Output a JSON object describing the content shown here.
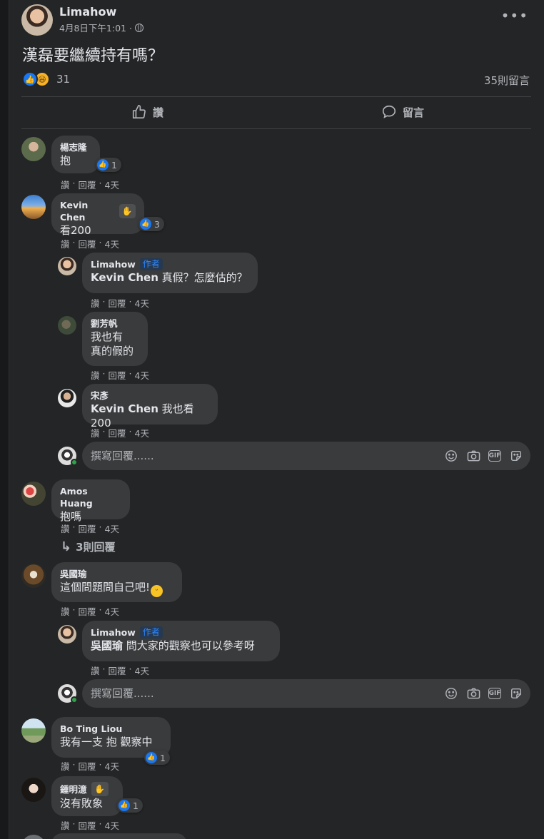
{
  "post": {
    "author": "Limahow",
    "date": "4月8日下午1:01 ·",
    "text": "漢磊要繼續持有嗎？",
    "reaction_count": "31",
    "comment_count": "35則留言",
    "like_label": "讚",
    "comment_label": "留言"
  },
  "common": {
    "like": "讚",
    "reply": "回覆",
    "sep": "·",
    "time": "4天",
    "author_tag": "作者",
    "reply_placeholder": "撰寫回覆......",
    "gif": "GIF"
  },
  "comments": [
    {
      "name": "楊志隆",
      "text": "抱",
      "likes": "1"
    },
    {
      "name": "Kevin Chen",
      "text": "看200",
      "likes": "3"
    },
    {
      "name": "Limahow",
      "mention": "Kevin Chen",
      "text": " 真假？怎麼估的？"
    },
    {
      "name": "劉芳帆",
      "text_line1": "我也有",
      "text_line2": "真的假的"
    },
    {
      "name": "宋彥",
      "mention": "Kevin Chen",
      "text": " 我也看200"
    },
    {
      "name": "Amos Huang",
      "text": "抱嗎",
      "view_replies": "3則回覆"
    },
    {
      "name": "吳國瑜",
      "text": "這個問題問自己吧!"
    },
    {
      "name": "Limahow",
      "mention": "吳國瑜",
      "text": " 問大家的觀察也可以參考呀"
    },
    {
      "name": "Bo Ting Liou",
      "text": "我有一支 抱 觀察中",
      "likes": "1"
    },
    {
      "name": "鍾明澺",
      "text": "沒有敗象",
      "likes": "1"
    }
  ]
}
